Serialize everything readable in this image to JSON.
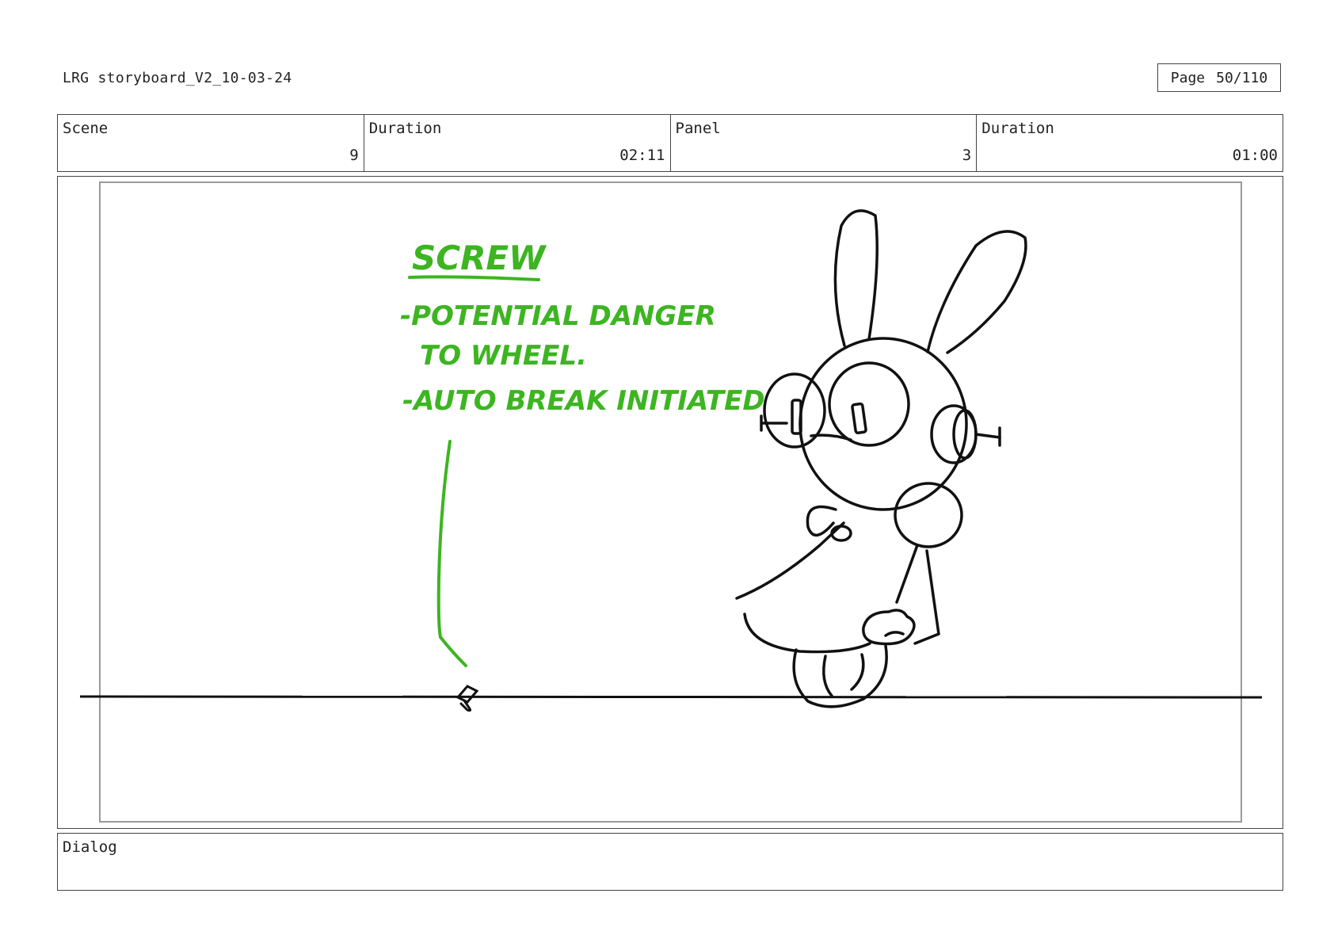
{
  "header": {
    "document_title": "LRG storyboard_V2_10-03-24",
    "page_label": "Page",
    "page_number": "50/110"
  },
  "info": {
    "scene_label": "Scene",
    "scene_value": "9",
    "scene_duration_label": "Duration",
    "scene_duration_value": "02:11",
    "panel_label": "Panel",
    "panel_value": "3",
    "panel_duration_label": "Duration",
    "panel_duration_value": "01:00"
  },
  "panel": {
    "annotation": {
      "title": "SCREW",
      "line1": "-POTENTIAL DANGER",
      "line2": "TO WHEEL.",
      "line3": "-AUTO BREAK INITIATED",
      "color": "#3cb521"
    }
  },
  "dialog": {
    "label": "Dialog",
    "text": ""
  }
}
